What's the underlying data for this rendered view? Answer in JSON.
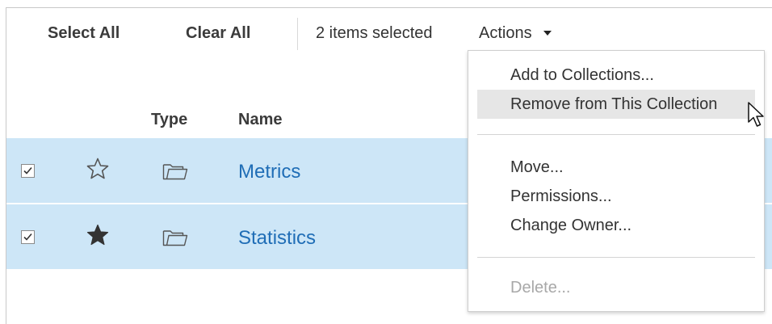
{
  "toolbar": {
    "select_all": "Select All",
    "clear_all": "Clear All",
    "selection_count": "2 items selected",
    "actions": "Actions"
  },
  "table": {
    "headers": {
      "type": "Type",
      "name": "Name"
    },
    "rows": [
      {
        "checked": true,
        "favorite": false,
        "type_icon": "folder-icon",
        "name": "Metrics"
      },
      {
        "checked": true,
        "favorite": true,
        "type_icon": "folder-icon",
        "name": "Statistics"
      }
    ]
  },
  "actions_menu": {
    "items": [
      {
        "label": "Add to Collections...",
        "state": "normal"
      },
      {
        "label": "Remove from This Collection",
        "state": "hover"
      },
      {
        "label": "Move...",
        "state": "normal"
      },
      {
        "label": "Permissions...",
        "state": "normal"
      },
      {
        "label": "Change Owner...",
        "state": "normal"
      },
      {
        "label": "Delete...",
        "state": "disabled"
      }
    ]
  },
  "colors": {
    "selected_row": "#cde6f7",
    "link": "#1f6db6",
    "menu_hover": "#e6e6e6",
    "disabled_text": "#a8a8a8"
  }
}
